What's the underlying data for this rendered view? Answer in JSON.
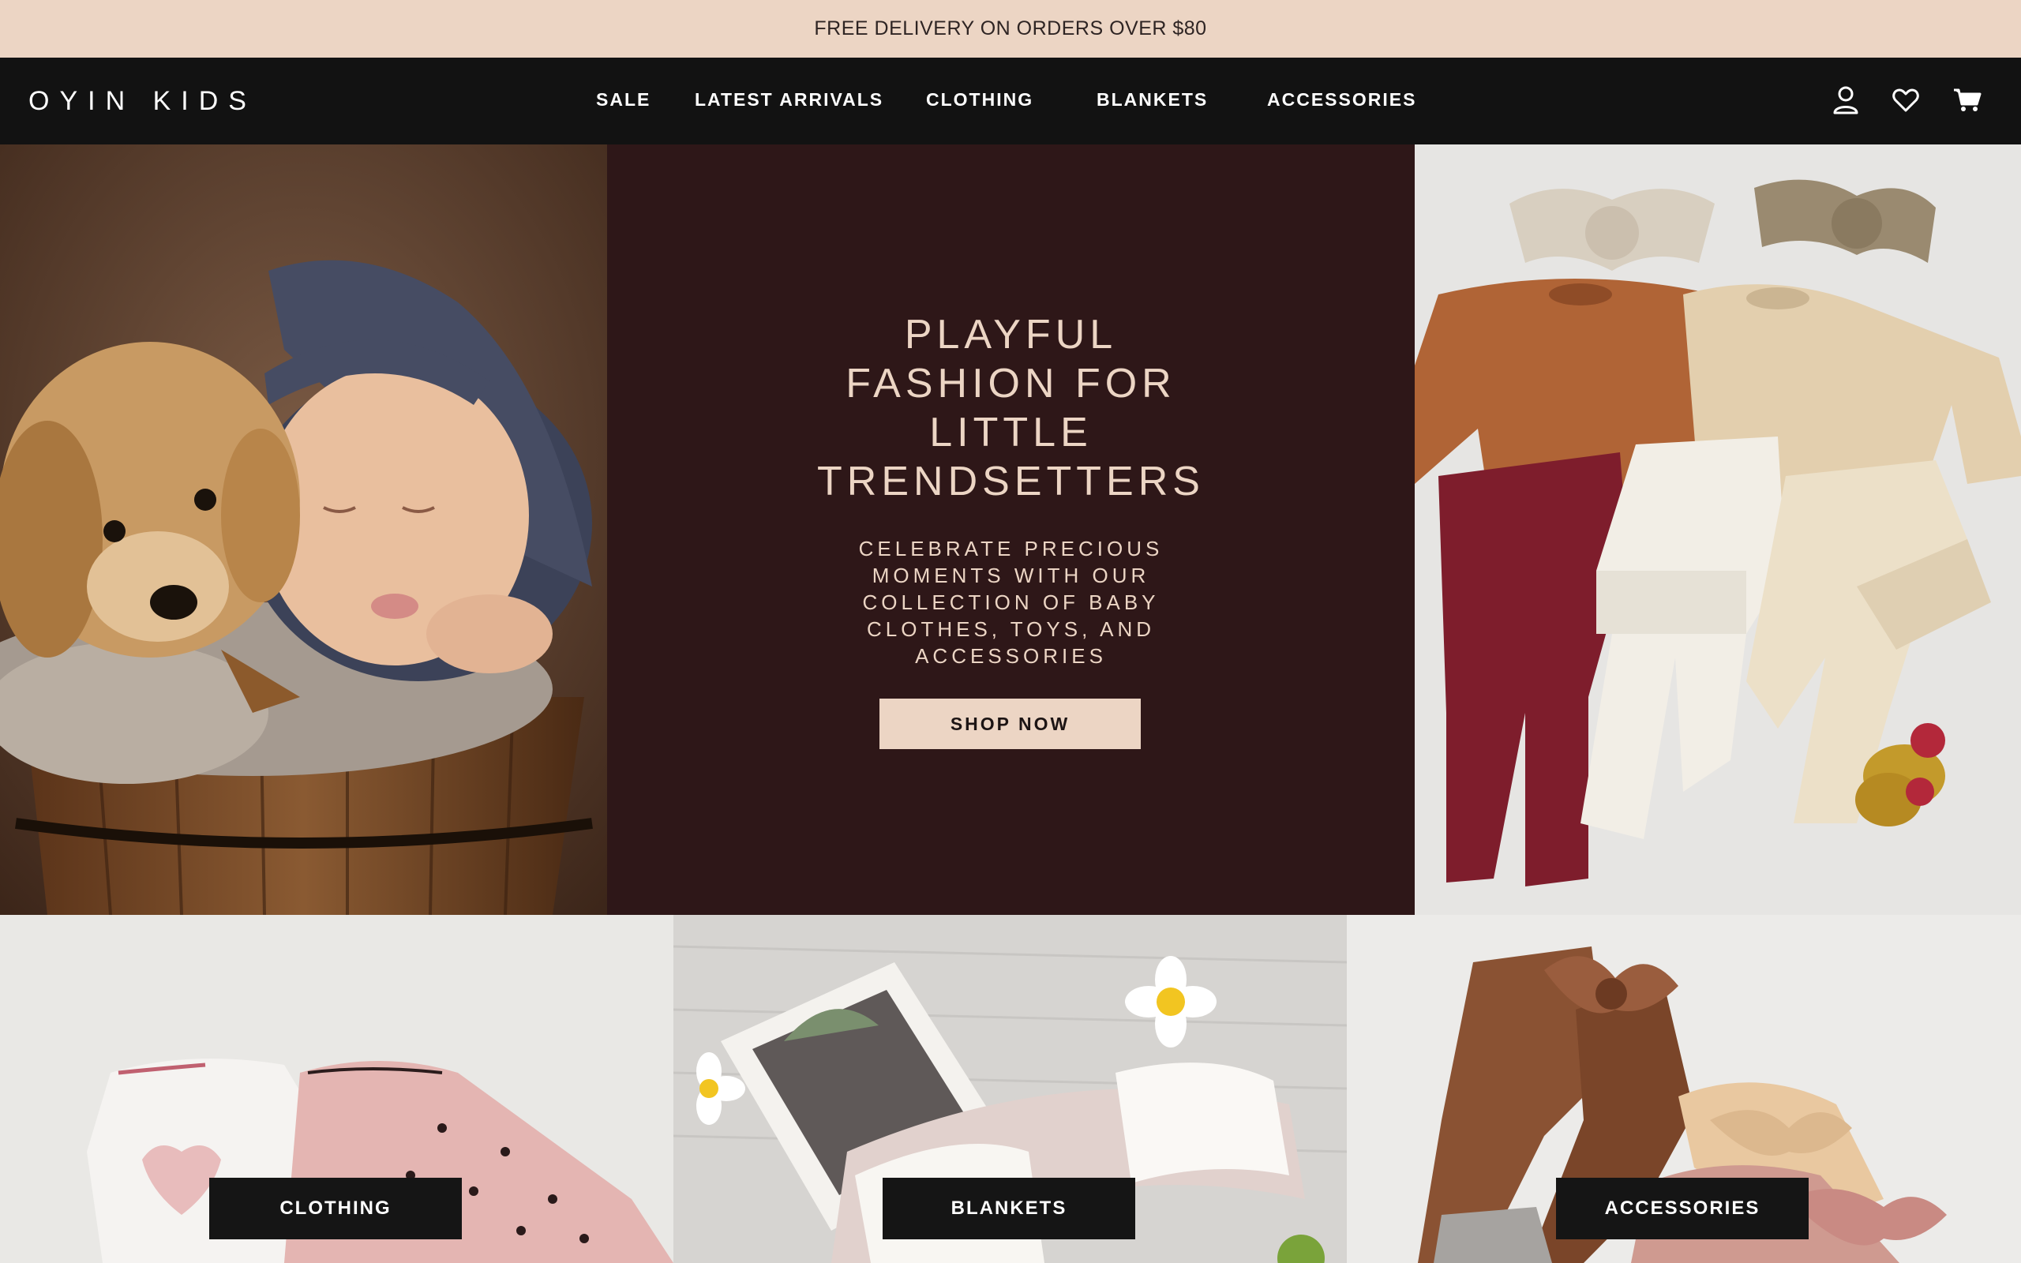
{
  "announcement": "FREE DELIVERY ON ORDERS OVER $80",
  "header": {
    "logo": "OYIN KIDS",
    "nav": [
      "SALE",
      "LATEST ARRIVALS",
      "CLOTHING",
      "BLANKETS",
      "ACCESSORIES"
    ],
    "icons": [
      "account-icon",
      "wishlist-heart-icon",
      "cart-icon"
    ]
  },
  "hero": {
    "title_lines": [
      "PLAYFUL",
      "FASHION FOR",
      "LITTLE",
      "TRENDSETTERS"
    ],
    "subtitle_lines": [
      "CELEBRATE PRECIOUS",
      "MOMENTS WITH OUR",
      "COLLECTION OF BABY",
      "CLOTHES, TOYS, AND",
      "ACCESSORIES"
    ],
    "cta": "SHOP NOW"
  },
  "tiles": [
    {
      "label": "CLOTHING"
    },
    {
      "label": "BLANKETS"
    },
    {
      "label": "ACCESSORIES"
    }
  ],
  "colors": {
    "announcement_bg": "#ecd5c4",
    "header_bg": "#121212",
    "hero_panel_bg": "#2e1718",
    "accent": "#ecd5c4"
  }
}
